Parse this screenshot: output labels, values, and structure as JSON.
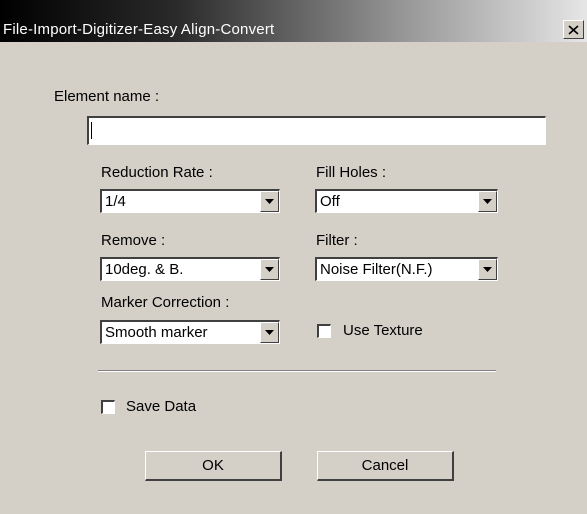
{
  "window": {
    "title": "File-Import-Digitizer-Easy Align-Convert",
    "close_icon": "close-icon"
  },
  "form": {
    "element_name_label": "Element name :",
    "element_name_value": "",
    "reduction_rate_label": "Reduction Rate :",
    "reduction_rate_value": "1/4",
    "fill_holes_label": "Fill Holes :",
    "fill_holes_value": "Off",
    "remove_label": "Remove :",
    "remove_value": "10deg. & B.",
    "filter_label": "Filter :",
    "filter_value": "Noise Filter(N.F.)",
    "marker_correction_label": "Marker Correction :",
    "marker_correction_value": "Smooth marker",
    "use_texture_label": "Use Texture",
    "use_texture_checked": false,
    "save_data_label": "Save Data",
    "save_data_checked": false
  },
  "buttons": {
    "ok_label": "OK",
    "cancel_label": "Cancel"
  },
  "colors": {
    "dialog_bg": "#d4d0c8",
    "title_text": "#ffffff"
  }
}
